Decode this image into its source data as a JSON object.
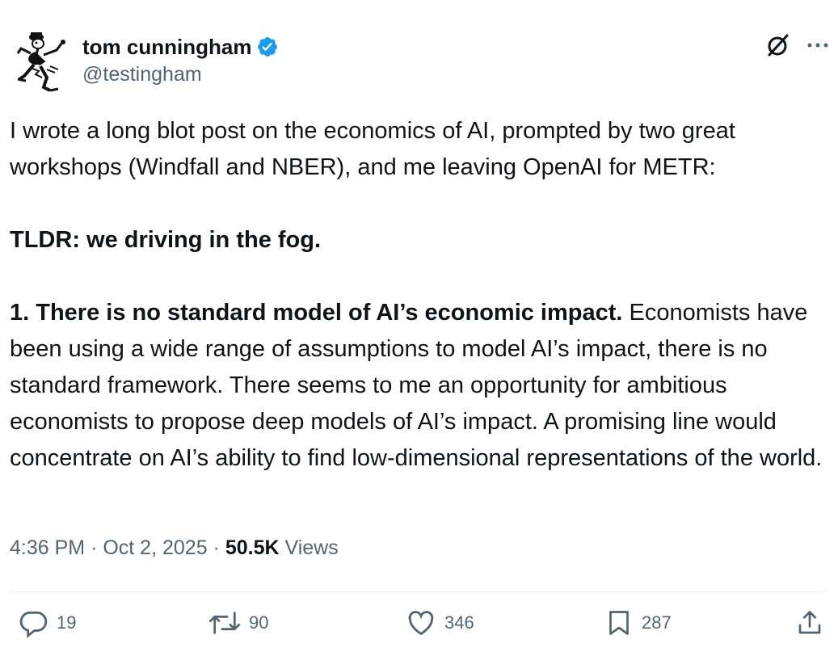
{
  "author": {
    "display_name": "tom cunningham",
    "handle": "@testingham",
    "verified_color": "#1d9bf0",
    "avatar_icon": "cartoon-figure-avatar"
  },
  "top_actions": {
    "grok_icon": "grok-icon",
    "more_icon": "more-icon"
  },
  "post": {
    "intro": "I wrote a long blot post on the economics of AI, prompted by two great workshops (Windfall and NBER), and me leaving OpenAI for METR:",
    "tldr": "TLDR: we driving in the fog.",
    "point1_bold": "1. There is no standard model of AI’s economic impact.",
    "point1_text": "Economists have been using a wide range of assumptions to model AI’s impact, there is no standard framework. There seems to me an opportunity for ambitious economists to propose deep models of AI’s impact. A promising line would concentrate on AI’s ability to find low-dimensional representations of the world."
  },
  "meta": {
    "time": "4:36 PM",
    "separator": "·",
    "date": "Oct 2, 2025",
    "views_count": "50.5K",
    "views_label": "Views"
  },
  "actions": {
    "replies": "19",
    "reposts": "90",
    "likes": "346",
    "bookmarks": "287"
  },
  "colors": {
    "text": "#0f1419",
    "secondary": "#536471",
    "divider": "#eff3f4"
  }
}
